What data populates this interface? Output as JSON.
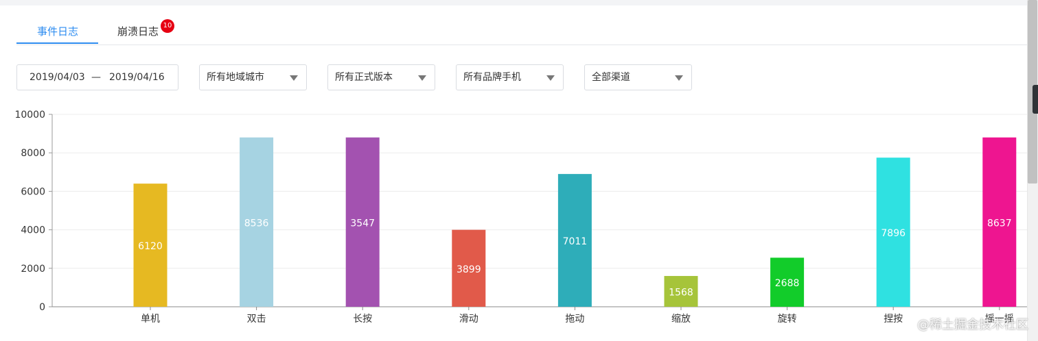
{
  "tabs": [
    {
      "label": "事件日志",
      "active": true
    },
    {
      "label": "崩溃日志",
      "active": false,
      "badge": "10"
    }
  ],
  "filters": {
    "date_start": "2019/04/03",
    "date_sep": "—",
    "date_end": "2019/04/16",
    "region": "所有地域城市",
    "version": "所有正式版本",
    "brand": "所有品牌手机",
    "channel": "全部渠道"
  },
  "colors": {
    "accent": "#2d8cf0",
    "badge": "#e60012"
  },
  "chart_data": {
    "type": "bar",
    "categories": [
      "单机",
      "双击",
      "长按",
      "滑动",
      "拖动",
      "缩放",
      "旋转",
      "捏按",
      "摇一摇"
    ],
    "values": [
      6400,
      8800,
      8800,
      4000,
      6900,
      1600,
      2550,
      7750,
      8800
    ],
    "data_labels": [
      "6120",
      "8536",
      "3547",
      "3899",
      "7011",
      "1568",
      "2688",
      "7896",
      "8637"
    ],
    "colors": [
      "#e6b922",
      "#a6d3e2",
      "#a352b0",
      "#e15a4a",
      "#2eadb9",
      "#a6c43a",
      "#12cc2a",
      "#2fe1e1",
      "#ee1590"
    ],
    "ylim": [
      0,
      10000
    ],
    "yticks": [
      0,
      2000,
      4000,
      6000,
      8000,
      10000
    ],
    "grid": true,
    "legend": "none",
    "title": "",
    "xlabel": "",
    "ylabel": ""
  },
  "watermark": "@稀土掘金技术社区"
}
